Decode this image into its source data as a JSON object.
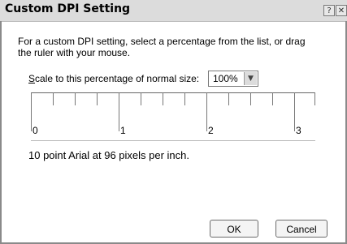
{
  "window": {
    "title": "Custom DPI Setting",
    "help_glyph": "?",
    "close_glyph": "✕"
  },
  "description": "For a custom DPI setting, select a percentage from the list, or drag the ruler with your mouse.",
  "scale": {
    "label_prefix": "",
    "label_underlined": "S",
    "label_rest": "cale to this percentage of normal size:",
    "selected_value": "100%",
    "dropdown_glyph": "▼"
  },
  "ruler": {
    "labels": [
      "0",
      "1",
      "2",
      "3"
    ]
  },
  "info_text": "10 point Arial at 96 pixels per inch.",
  "buttons": {
    "ok": "OK",
    "cancel": "Cancel"
  }
}
